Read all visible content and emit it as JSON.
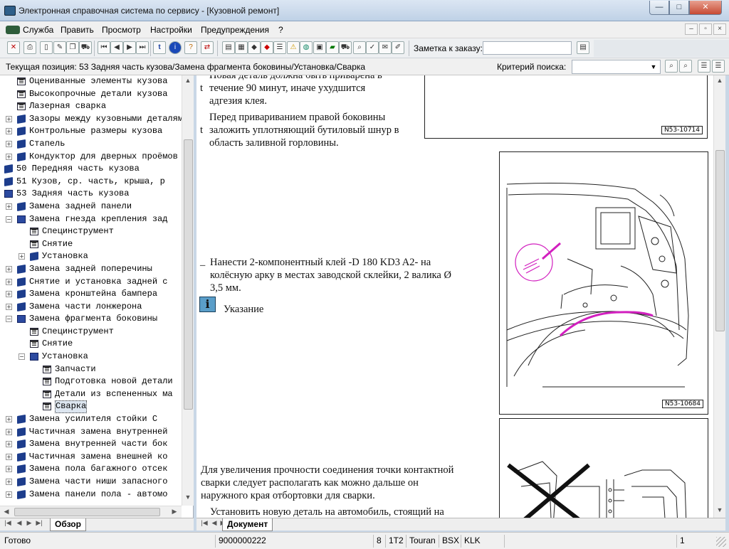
{
  "window": {
    "title": "Электронная справочная система по сервису - [Кузовной ремонт]",
    "min": "—",
    "max": "□",
    "close": "✕"
  },
  "menu": {
    "items": [
      {
        "label": "Служба",
        "key": "С"
      },
      {
        "label": "Править",
        "key": "П"
      },
      {
        "label": "Просмотр",
        "key": "П"
      },
      {
        "label": "Настройки",
        "key": "Н"
      },
      {
        "label": "Предупреждения",
        "key": "П"
      },
      {
        "label": "?",
        "key": "?"
      }
    ]
  },
  "toolbar": {
    "order_label": "Заметка к заказу:",
    "order_value": ""
  },
  "position": {
    "text": "Текущая позиция: 53 Задняя часть кузова/Замена фрагмента боковины/Установка/Сварка",
    "criteria_label": "Критерий поиска:",
    "criteria_value": ""
  },
  "tree": {
    "items": [
      {
        "label": "Оцениванные элементы кузова",
        "indent": 1,
        "icon": "page",
        "exp": ""
      },
      {
        "label": "Высокопрочные детали кузова",
        "indent": 1,
        "icon": "page",
        "exp": ""
      },
      {
        "label": "Лазерная сварка",
        "indent": 1,
        "icon": "page",
        "exp": ""
      },
      {
        "label": "Зазоры между кузовными деталями",
        "indent": 1,
        "icon": "book",
        "exp": "+"
      },
      {
        "label": "Контрольные размеры кузова",
        "indent": 1,
        "icon": "book",
        "exp": "+"
      },
      {
        "label": "Стапель",
        "indent": 1,
        "icon": "book",
        "exp": "+"
      },
      {
        "label": "Кондуктор для дверных проёмов",
        "indent": 1,
        "icon": "book",
        "exp": "+"
      },
      {
        "label": "50 Передняя часть кузова",
        "indent": 0,
        "icon": "book",
        "exp": ""
      },
      {
        "label": "51 Кузов, ср. часть, крыша, р",
        "indent": 0,
        "icon": "book",
        "exp": ""
      },
      {
        "label": "53 Задняя часть кузова",
        "indent": 0,
        "icon": "open",
        "exp": ""
      },
      {
        "label": "Замена задней панели",
        "indent": 1,
        "icon": "book",
        "exp": "+"
      },
      {
        "label": "Замена гнезда крепления зад",
        "indent": 1,
        "icon": "open",
        "exp": "−"
      },
      {
        "label": "Специнструмент",
        "indent": 2,
        "icon": "page",
        "exp": ""
      },
      {
        "label": "Снятие",
        "indent": 2,
        "icon": "page",
        "exp": ""
      },
      {
        "label": "Установка",
        "indent": 2,
        "icon": "book",
        "exp": "+"
      },
      {
        "label": "Замена задней поперечины",
        "indent": 1,
        "icon": "book",
        "exp": "+"
      },
      {
        "label": "Снятие и установка задней с",
        "indent": 1,
        "icon": "book",
        "exp": "+"
      },
      {
        "label": "Замена кронштейна бампера",
        "indent": 1,
        "icon": "book",
        "exp": "+"
      },
      {
        "label": "Замена части лонжерона",
        "indent": 1,
        "icon": "book",
        "exp": "+"
      },
      {
        "label": "Замена фрагмента боковины",
        "indent": 1,
        "icon": "open",
        "exp": "−"
      },
      {
        "label": "Специнструмент",
        "indent": 2,
        "icon": "page",
        "exp": ""
      },
      {
        "label": "Снятие",
        "indent": 2,
        "icon": "page",
        "exp": ""
      },
      {
        "label": "Установка",
        "indent": 2,
        "icon": "open",
        "exp": "−"
      },
      {
        "label": "Запчасти",
        "indent": 3,
        "icon": "page",
        "exp": ""
      },
      {
        "label": "Подготовка новой детали",
        "indent": 3,
        "icon": "page",
        "exp": ""
      },
      {
        "label": "Детали из вспененных ма",
        "indent": 3,
        "icon": "page",
        "exp": ""
      },
      {
        "label": "Сварка",
        "indent": 3,
        "icon": "page",
        "exp": "",
        "selected": true
      },
      {
        "label": "Замена усилителя стойки С",
        "indent": 1,
        "icon": "book",
        "exp": "+"
      },
      {
        "label": "Частичная замена внутренней",
        "indent": 1,
        "icon": "book",
        "exp": "+"
      },
      {
        "label": "Замена внутренней части бок",
        "indent": 1,
        "icon": "book",
        "exp": "+"
      },
      {
        "label": "Частичная замена внешней ко",
        "indent": 1,
        "icon": "book",
        "exp": "+"
      },
      {
        "label": "Замена пола багажного отсек",
        "indent": 1,
        "icon": "book",
        "exp": "+"
      },
      {
        "label": "Замена части ниши запасного",
        "indent": 1,
        "icon": "book",
        "exp": "+"
      },
      {
        "label": "Замена панели пола - автомо",
        "indent": 1,
        "icon": "book",
        "exp": "+"
      }
    ]
  },
  "doc": {
    "p1_l0": "Новая деталь должна быть приварена в",
    "p1_l1": "течение 90 минут, иначе ухудшится",
    "p1_l2": "адгезия клея.",
    "p2_l0": "Перед привариванием правой боковины",
    "p2_l1": "заложить уплотняющий бутиловый шнур в",
    "p2_l2": "область заливной горловины.",
    "bullet": "t",
    "dash": "–",
    "p3_l0": "Нанести 2-компонентный клей -D 180 KD3 A2- на",
    "p3_l1": "колёсную арку в местах заводской склейки, 2 валика Ø",
    "p3_l2": "3,5 мм.",
    "note": "Указание",
    "note_icon": "i",
    "p4_l0": "Для увеличения прочности соединения точки контактной",
    "p4_l1": "сварки следует располагать как можно дальше он",
    "p4_l2": "наружного края отбортовки для сварки.",
    "p5_l0": "Установить новую деталь на автомобиль, стоящий на",
    "fig1": "N53-10714",
    "fig2": "N53-10684"
  },
  "tabs": {
    "left": "Обзор",
    "right": "Документ"
  },
  "status": {
    "ready": "Готово",
    "number": "9000000222",
    "s1": "8",
    "s2": "1T2",
    "s3": "Touran",
    "s4": "BSX",
    "s5": "KLK",
    "page": "1"
  }
}
